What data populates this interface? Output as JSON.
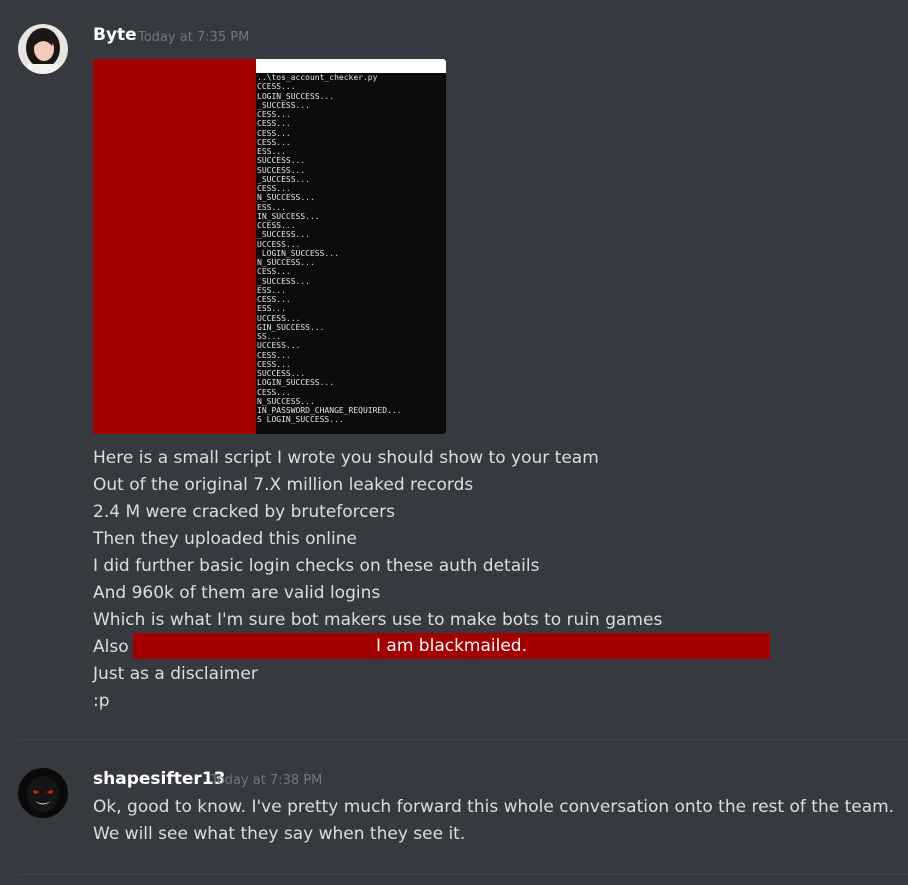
{
  "messages": [
    {
      "author": "Byte",
      "timestamp": "Today at 7:35 PM",
      "avatar": "portrait-photo",
      "terminal": {
        "lines": [
          "..\\tos_account_checker.py",
          "CCESS...",
          "LOGIN_SUCCESS...",
          "_SUCCESS...",
          "CESS...",
          "CESS...",
          "CESS...",
          "CESS...",
          "ESS...",
          "SUCCESS...",
          "SUCCESS...",
          "_SUCCESS...",
          "CESS...",
          "N_SUCCESS...",
          "ESS...",
          "IN_SUCCESS...",
          "CCESS...",
          "_SUCCESS...",
          "UCCESS...",
          " LOGIN_SUCCESS...",
          "N_SUCCESS...",
          "CESS...",
          "_SUCCESS...",
          "ESS...",
          "CESS...",
          "ESS...",
          "UCCESS...",
          "GIN_SUCCESS...",
          "SS...",
          "UCCESS...",
          "CESS...",
          "CESS...",
          "SUCCESS...",
          "LOGIN_SUCCESS...",
          "CESS...",
          "N_SUCCESS...",
          "IN_PASSWORD_CHANGE_REQUIRED...",
          "S LOGIN_SUCCESS..."
        ]
      },
      "lines": [
        "Here is a small script I wrote you should show to your team",
        "Out of the original 7.X million leaked records",
        "2.4 M were cracked by bruteforcers",
        "Then they uploaded this online",
        "I did further basic login checks on these auth details",
        "And 960k of them are valid logins",
        "Which is what I'm sure bot makers use to make bots to ruin games",
        "Also",
        "Just as a disclaimer",
        ":p"
      ],
      "redacted_overlay": "I am blackmailed."
    },
    {
      "author": "shapesifter13",
      "timestamp": "Today at 7:38 PM",
      "avatar": "dark-creature-avatar",
      "lines": [
        "Ok, good to know. I've pretty much forward this whole conversation onto the rest of the team.",
        "We will see what they say when they see it."
      ]
    }
  ],
  "colors": {
    "background": "#36393f",
    "text": "#dcddde",
    "username": "#ffffff",
    "timestamp": "#72767d",
    "redaction": "#a50000"
  }
}
